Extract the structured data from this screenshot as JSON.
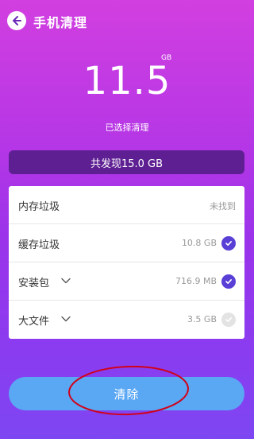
{
  "header": {
    "title": "手机清理",
    "back_icon": "arrow-left-icon"
  },
  "summary": {
    "size_value": "11.5",
    "size_unit": "GB",
    "selected_label": "已选择清理",
    "found_text": "共发现15.0 GB"
  },
  "items": [
    {
      "label": "内存垃圾",
      "value": "未找到",
      "has_chevron": false,
      "check": "none"
    },
    {
      "label": "缓存垃圾",
      "value": "10.8 GB",
      "has_chevron": false,
      "check": "checked"
    },
    {
      "label": "安装包",
      "value": "716.9 MB",
      "has_chevron": true,
      "check": "checked"
    },
    {
      "label": "大文件",
      "value": "3.5 GB",
      "has_chevron": true,
      "check": "unchecked"
    }
  ],
  "action": {
    "clean_label": "清除"
  },
  "colors": {
    "accent": "#5a3fd6",
    "button": "#5aa7f4",
    "found_bar": "#5e1f93",
    "annotation": "#d0021b"
  }
}
